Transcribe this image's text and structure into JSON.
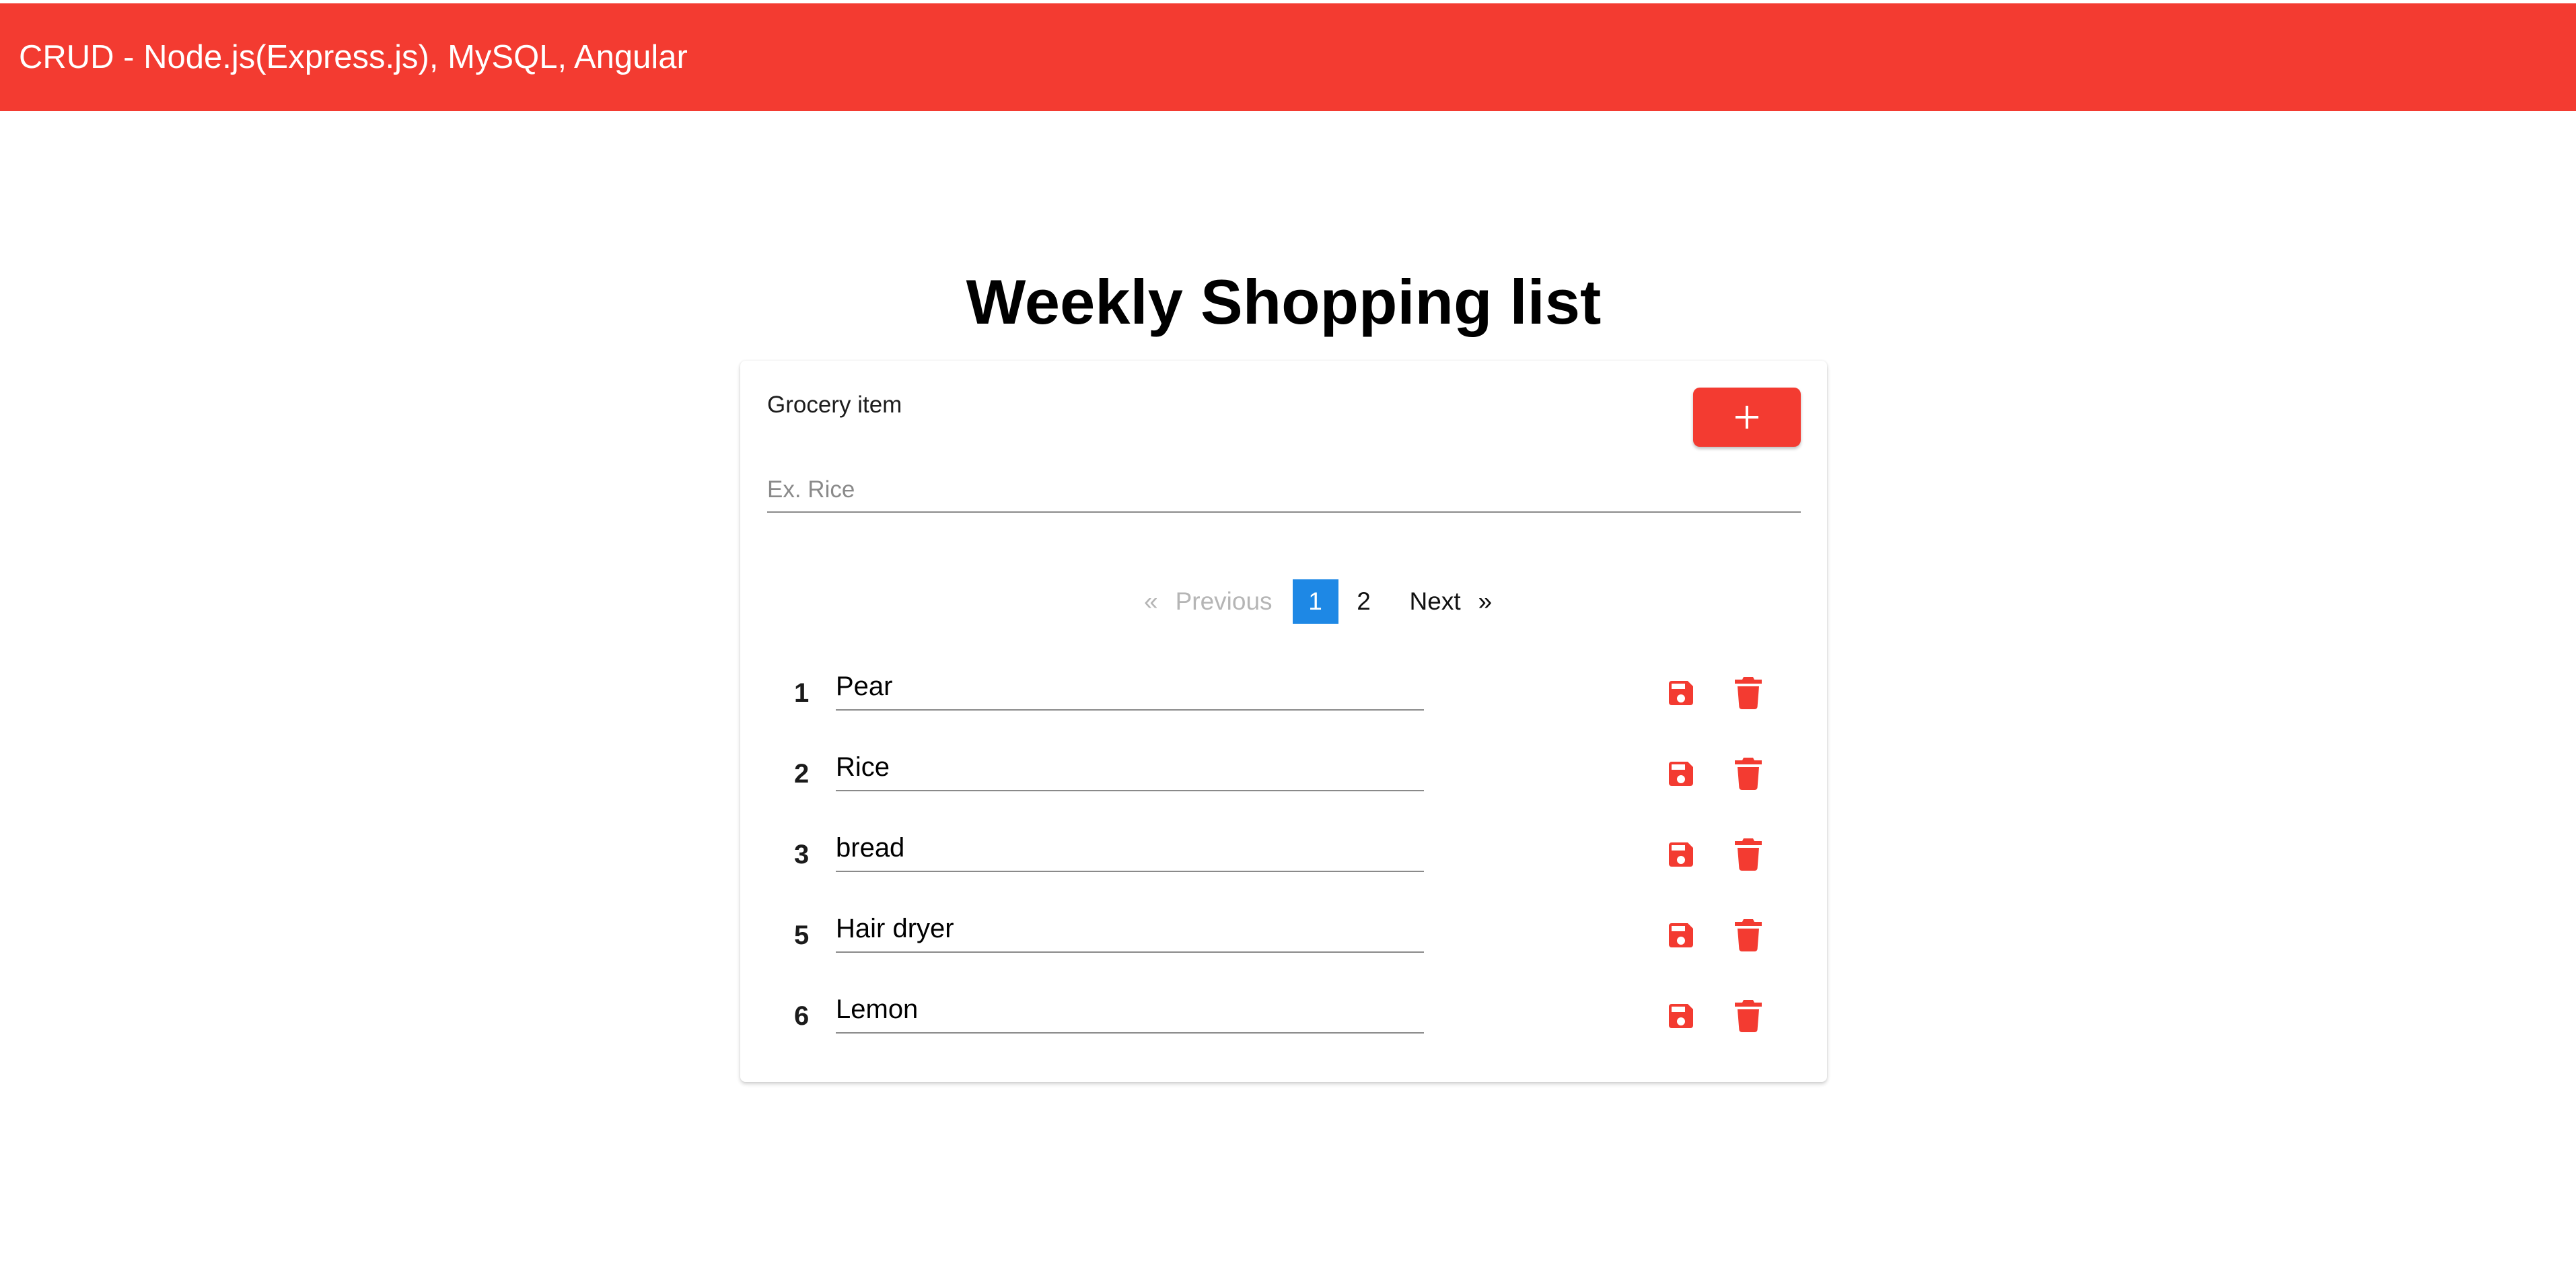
{
  "app": {
    "title": "CRUD - Node.js(Express.js), MySQL, Angular"
  },
  "page": {
    "title": "Weekly Shopping list"
  },
  "form": {
    "label": "Grocery item",
    "placeholder": "Ex. Rice",
    "add_icon": "plus-icon"
  },
  "pagination": {
    "prev_arrow": "«",
    "prev_label": "Previous",
    "pages": [
      "1",
      "2"
    ],
    "current_page": "1",
    "next_label": "Next",
    "next_arrow": "»"
  },
  "items": [
    {
      "id": "1",
      "name": "Pear"
    },
    {
      "id": "2",
      "name": "Rice"
    },
    {
      "id": "3",
      "name": "bread"
    },
    {
      "id": "5",
      "name": "Hair dryer"
    },
    {
      "id": "6",
      "name": "Lemon"
    }
  ],
  "icons": {
    "save": "floppy-disk-icon",
    "delete": "trash-icon"
  },
  "colors": {
    "primary": "#f33b31",
    "active_page": "#1e88e5"
  }
}
